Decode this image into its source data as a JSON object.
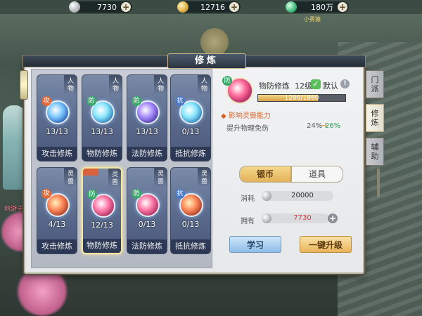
{
  "currencies": {
    "silver": "7730",
    "gold": "12716",
    "jade": "180万"
  },
  "scene": {
    "pet_name": "小勇猿",
    "player_name": "网游子"
  },
  "panel": {
    "title": "修炼"
  },
  "cards": [
    {
      "category": "人物",
      "tag": "攻",
      "level": "13/13",
      "name": "攻击修炼"
    },
    {
      "category": "人物",
      "tag": "防",
      "level": "13/13",
      "name": "物防修炼"
    },
    {
      "category": "人物",
      "tag": "防",
      "level": "13/13",
      "name": "法防修炼"
    },
    {
      "category": "人物",
      "tag": "抗",
      "level": "0/13",
      "name": "抵抗修炼"
    },
    {
      "category": "灵兽",
      "tag": "攻",
      "level": "4/13",
      "name": "攻击修炼"
    },
    {
      "category": "灵兽",
      "tag": "防",
      "level": "12/13",
      "name": "物防修炼"
    },
    {
      "category": "灵兽",
      "tag": "防",
      "level": "0/13",
      "name": "法防修炼"
    },
    {
      "category": "灵兽",
      "tag": "抗",
      "level": "0/13",
      "name": "抵抗修炼"
    }
  ],
  "detail": {
    "tag": "防",
    "name": "物防修炼",
    "level": "12级",
    "default_label": "默认",
    "exp": "1280/1860",
    "exp_fraction": 0.688,
    "effect_title": "影响灵兽能力",
    "effect_label": "提升物理免伤",
    "current": "24%",
    "next": "26%"
  },
  "payment": {
    "tab_silver": "银币",
    "tab_item": "道具",
    "cost_label": "消耗",
    "cost_value": "20000",
    "own_label": "拥有",
    "own_value": "7730"
  },
  "buttons": {
    "learn": "学习",
    "upgrade": "一键升级"
  },
  "side_tabs": [
    {
      "line1": "门",
      "line2": "派"
    },
    {
      "line1": "修",
      "line2": "炼"
    },
    {
      "line1": "辅",
      "line2": "助"
    }
  ],
  "colors": {
    "owned_insufficient": "#d83a3a",
    "effect_title": "#d8622a",
    "effect_next": "#2aa05a"
  }
}
